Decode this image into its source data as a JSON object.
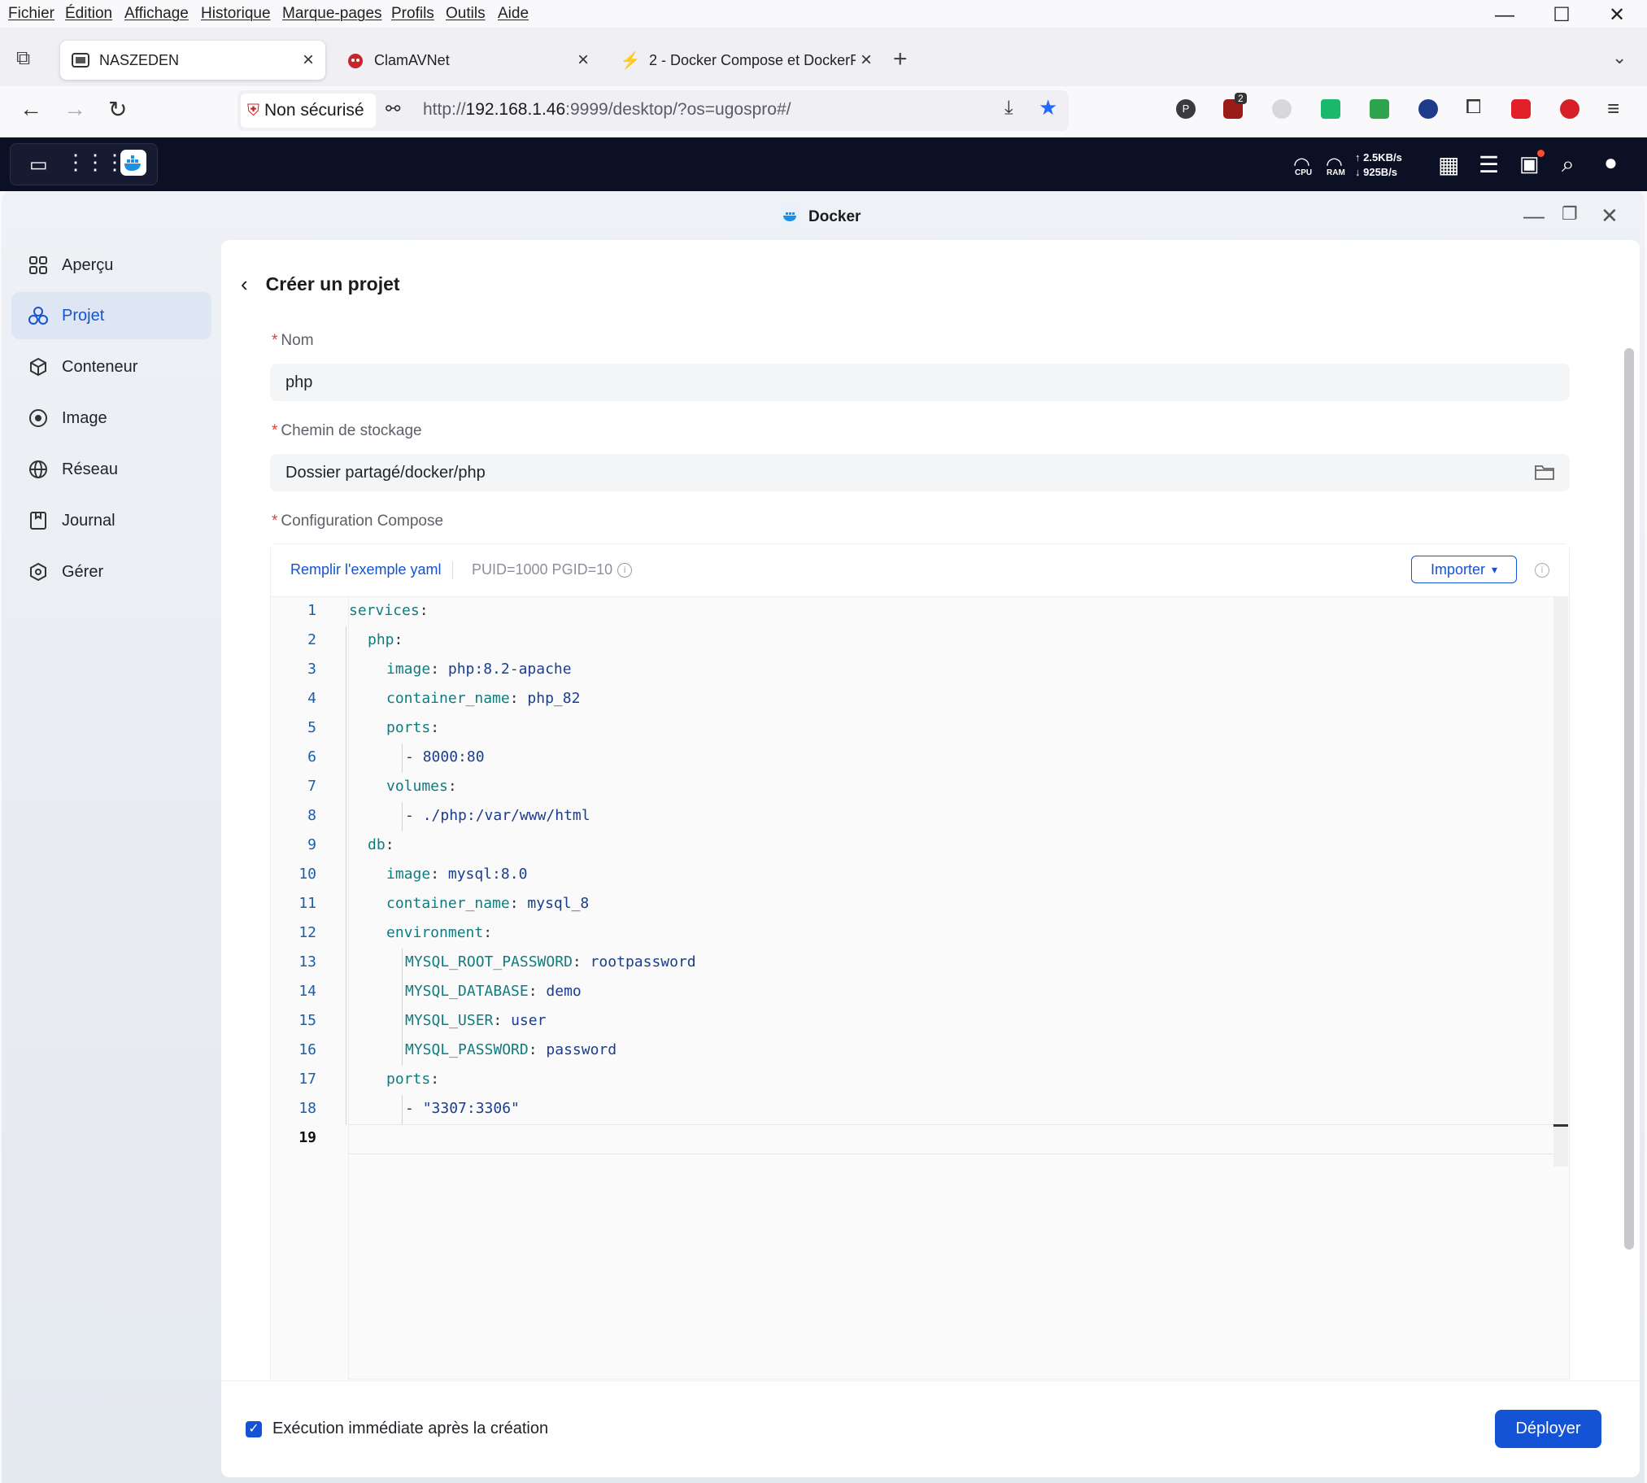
{
  "browser": {
    "menu": [
      "Fichier",
      "Édition",
      "Affichage",
      "Historique",
      "Marque-pages",
      "Profils",
      "Outils",
      "Aide"
    ],
    "tabs": [
      {
        "label": "NASZEDEN",
        "active": true
      },
      {
        "label": "ClamAVNet",
        "active": false
      },
      {
        "label": "2 - Docker Compose et DockerF",
        "active": false
      }
    ],
    "security_label": "Non sécurisé",
    "url_prefix": "http://",
    "url_host": "192.168.1.46",
    "url_rest": ":9999/desktop/?os=ugospro#/",
    "ext_badge": "2"
  },
  "nas": {
    "cpu_label": "CPU",
    "ram_label": "RAM",
    "upload": "↑ 2.5KB/s",
    "download": "↓ 925B/s"
  },
  "window": {
    "title": "Docker"
  },
  "sidebar": {
    "items": [
      {
        "label": "Aperçu",
        "icon": "grid-icon"
      },
      {
        "label": "Projet",
        "icon": "hexagon-nodes-icon",
        "active": true
      },
      {
        "label": "Conteneur",
        "icon": "cube-icon"
      },
      {
        "label": "Image",
        "icon": "disc-icon"
      },
      {
        "label": "Réseau",
        "icon": "globe-icon"
      },
      {
        "label": "Journal",
        "icon": "log-icon"
      },
      {
        "label": "Gérer",
        "icon": "settings-icon"
      }
    ]
  },
  "form": {
    "title": "Créer un projet",
    "name_label": "Nom",
    "name_value": "php",
    "path_label": "Chemin de stockage",
    "path_value": "Dossier partagé/docker/php",
    "compose_label": "Configuration Compose",
    "fill_yaml": "Remplir l'exemple yaml",
    "puid_hint": "PUID=1000 PGID=10",
    "import_label": "Importer"
  },
  "editor": {
    "lines": [
      {
        "n": "1",
        "indent": 0,
        "key": "services",
        "val": ""
      },
      {
        "n": "2",
        "indent": 1,
        "key": "php",
        "val": ""
      },
      {
        "n": "3",
        "indent": 2,
        "key": "image",
        "val": "php:8.2-apache"
      },
      {
        "n": "4",
        "indent": 2,
        "key": "container_name",
        "val": "php_82"
      },
      {
        "n": "5",
        "indent": 2,
        "key": "ports",
        "val": ""
      },
      {
        "n": "6",
        "indent": 3,
        "key": "",
        "val": "8000:80",
        "dash": true
      },
      {
        "n": "7",
        "indent": 2,
        "key": "volumes",
        "val": ""
      },
      {
        "n": "8",
        "indent": 3,
        "key": "",
        "val": "./php:/var/www/html",
        "dash": true
      },
      {
        "n": "9",
        "indent": 1,
        "key": "db",
        "val": ""
      },
      {
        "n": "10",
        "indent": 2,
        "key": "image",
        "val": "mysql:8.0"
      },
      {
        "n": "11",
        "indent": 2,
        "key": "container_name",
        "val": "mysql_8"
      },
      {
        "n": "12",
        "indent": 2,
        "key": "environment",
        "val": ""
      },
      {
        "n": "13",
        "indent": 3,
        "key": "MYSQL_ROOT_PASSWORD",
        "val": "rootpassword"
      },
      {
        "n": "14",
        "indent": 3,
        "key": "MYSQL_DATABASE",
        "val": "demo"
      },
      {
        "n": "15",
        "indent": 3,
        "key": "MYSQL_USER",
        "val": "user"
      },
      {
        "n": "16",
        "indent": 3,
        "key": "MYSQL_PASSWORD",
        "val": "password"
      },
      {
        "n": "17",
        "indent": 2,
        "key": "ports",
        "val": ""
      },
      {
        "n": "18",
        "indent": 3,
        "key": "",
        "val": "\"3307:3306\"",
        "dash": true
      },
      {
        "n": "19",
        "indent": 0,
        "key": "",
        "val": ""
      }
    ]
  },
  "footer": {
    "checkbox_label": "Exécution immédiate après la création",
    "checkbox_checked": true,
    "deploy_label": "Déployer"
  },
  "colors": {
    "accent": "#1453d6",
    "required": "#e5393b",
    "yaml_key": "#0f7d80",
    "yaml_value": "#1a3d8f",
    "nas_bar": "#0c1024"
  }
}
